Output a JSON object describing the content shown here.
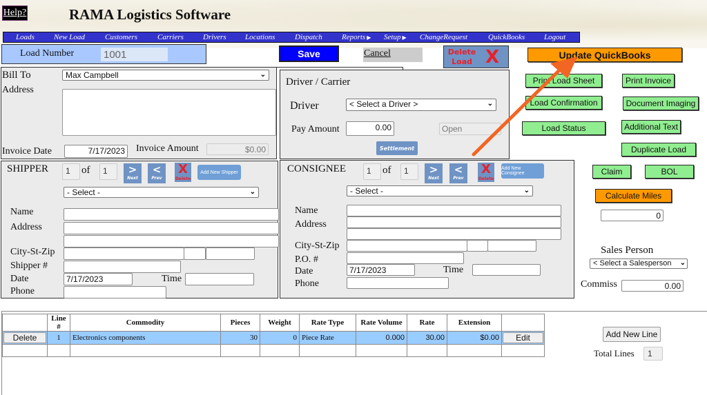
{
  "app": {
    "title": "RAMA Logistics Software",
    "help_label": "Help?"
  },
  "nav": {
    "items": [
      {
        "label": "Loads",
        "has_submenu": false
      },
      {
        "label": "New Load",
        "has_submenu": false
      },
      {
        "label": "Customers",
        "has_submenu": false
      },
      {
        "label": "Carriers",
        "has_submenu": false
      },
      {
        "label": "Drivers",
        "has_submenu": false
      },
      {
        "label": "Locations",
        "has_submenu": false
      },
      {
        "label": "Dispatch",
        "has_submenu": false
      },
      {
        "label": "Reports",
        "has_submenu": true
      },
      {
        "label": "Setup",
        "has_submenu": true
      },
      {
        "label": "ChangeRequest",
        "has_submenu": false
      },
      {
        "label": "QuickBooks",
        "has_submenu": false
      },
      {
        "label": "Logout",
        "has_submenu": false
      }
    ],
    "submenu_arrow": "▶"
  },
  "toolbar": {
    "load_number_label": "Load Number",
    "load_number_value": "1001",
    "save_label": "Save",
    "cancel_label": "Cancel",
    "delete_load_label_1": "Delete",
    "delete_load_label_2": "Load",
    "delete_icon": "X",
    "update_quickbooks_label": "Update QuickBooks"
  },
  "bill_to": {
    "bill_to_label": "Bill To",
    "bill_to_value": "Max Campbell",
    "address_label": "Address",
    "address_value": "",
    "invoice_date_label": "Invoice Date",
    "invoice_date_value": "7/17/2023",
    "invoice_amount_label": "Invoice Amount",
    "invoice_amount_value": "$0.00"
  },
  "driver": {
    "section_title": "Driver / Carrier",
    "driver_label": "Driver",
    "driver_value": "< Select a Driver >",
    "pay_amount_label": "Pay Amount",
    "pay_amount_value": "0.00",
    "status_value": "Open",
    "settlement_label": "Settlement"
  },
  "actions": {
    "print_load_sheet": "Print Load Sheet",
    "print_invoice": "Print Invoice",
    "load_confirmation": "Load Confirmation",
    "document_imaging": "Document Imaging",
    "load_status": "Load Status",
    "additional_text": "Additional Text",
    "duplicate_load": "Duplicate Load",
    "claim": "Claim",
    "bol": "BOL",
    "calculate_miles": "Calculate Miles",
    "miles_value": "0",
    "sales_person_label": "Sales Person",
    "sales_person_value": "< Select a Salesperson",
    "commiss_label": "Commiss",
    "commiss_value": "0.00"
  },
  "shipper": {
    "title": "SHIPPER",
    "index": "1",
    "of_label": "of",
    "total": "1",
    "next_label": "Next",
    "prev_label": "Prev",
    "delete_label": "Delete",
    "next_symbol": ">",
    "prev_symbol": "<",
    "delete_symbol": "X",
    "add_new_label": "Add New Shipper",
    "select_value": "- Select -",
    "name_label": "Name",
    "address_label": "Address",
    "city_label": "City-St-Zip",
    "ref_label": "Shipper #",
    "date_label": "Date",
    "date_value": "7/17/2023",
    "time_label": "Time",
    "phone_label": "Phone"
  },
  "consignee": {
    "title": "CONSIGNEE",
    "index": "1",
    "of_label": "of",
    "total": "1",
    "next_label": "Next",
    "prev_label": "Prev",
    "delete_label": "Delete",
    "next_symbol": ">",
    "prev_symbol": "<",
    "delete_symbol": "X",
    "add_new_label": "Add New Consignee",
    "select_value": "- Select -",
    "name_label": "Name",
    "address_label": "Address",
    "city_label": "City-St-Zip",
    "ref_label": "P.O. #",
    "date_label": "Date",
    "date_value": "7/17/2023",
    "time_label": "Time",
    "phone_label": "Phone"
  },
  "lines": {
    "columns": [
      "",
      "Line #",
      "Commodity",
      "Pieces",
      "Weight",
      "Rate Type",
      "Rate Volume",
      "Rate",
      "Extension",
      ""
    ],
    "rows": [
      {
        "delete_label": "Delete",
        "line": "1",
        "commodity": "Electronics components",
        "pieces": "30",
        "weight": "0",
        "rate_type": "Piece Rate",
        "rate_volume": "0.000",
        "rate": "30.00",
        "extension": "$0.00",
        "edit_label": "Edit"
      }
    ],
    "add_new_line_label": "Add New Line",
    "total_lines_label": "Total Lines",
    "total_lines_value": "1"
  },
  "colors": {
    "nav_bg": "#3333cc",
    "save_bg": "#0000ff",
    "accent_orange": "#ff9900",
    "action_green": "#90ee90",
    "steel_blue": "#6f93c4",
    "selected_row": "#99ccff",
    "annotation_arrow": "#f26522"
  }
}
